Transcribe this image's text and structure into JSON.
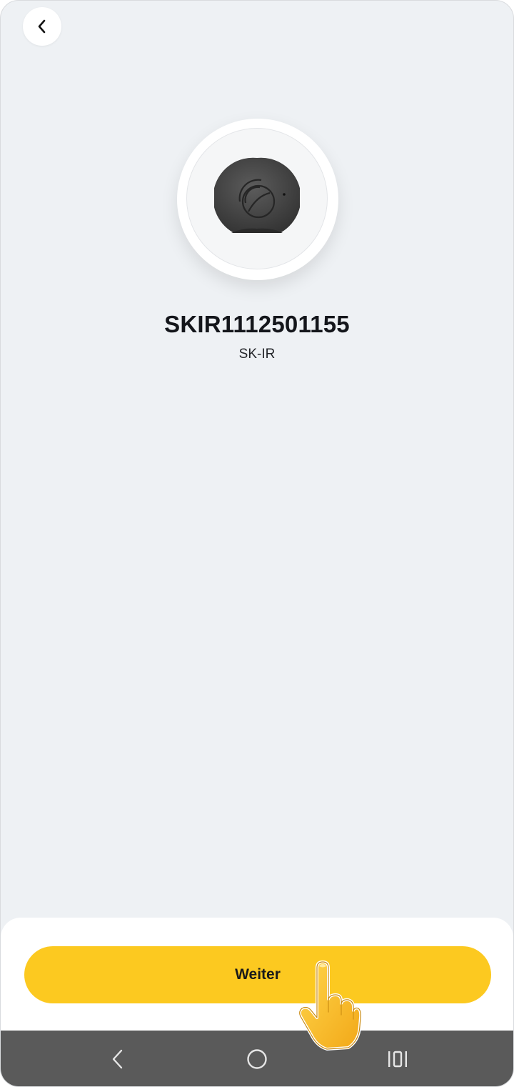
{
  "header": {
    "back_icon": "chevron-left-icon"
  },
  "device": {
    "image_icon": "ir-blaster-device-icon",
    "serial": "SKIR1112501155",
    "model": "SK-IR"
  },
  "footer": {
    "continue_label": "Weiter"
  },
  "system_nav": {
    "back_icon": "nav-back-icon",
    "home_icon": "nav-home-icon",
    "recents_icon": "nav-recents-icon"
  },
  "overlay": {
    "pointer_icon": "pointing-hand-icon"
  },
  "colors": {
    "background": "#eef1f4",
    "accent": "#fcc920",
    "nav_bar": "#5a5a5a",
    "text_primary": "#14161b"
  }
}
